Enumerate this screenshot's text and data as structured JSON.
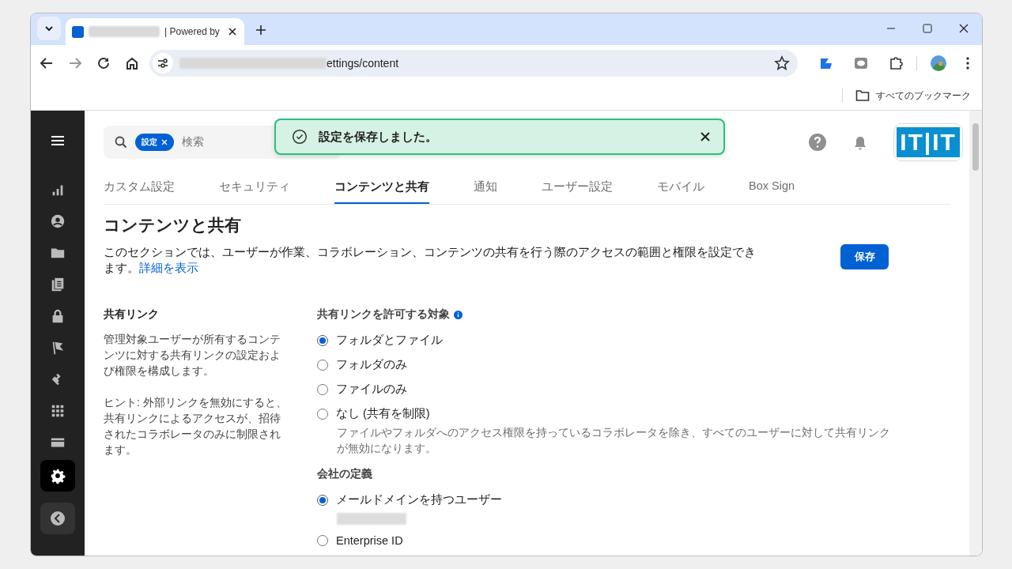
{
  "browser": {
    "tab_title": "| Powered by",
    "url": "ettings/content",
    "bookmarks_label": "すべてのブックマーク"
  },
  "sidebar": {
    "items": [
      {
        "kind": "reports",
        "selected": false
      },
      {
        "kind": "users",
        "selected": false
      },
      {
        "kind": "content",
        "selected": false
      },
      {
        "kind": "copies",
        "selected": false
      },
      {
        "kind": "security",
        "selected": false
      },
      {
        "kind": "flags",
        "selected": false
      },
      {
        "kind": "integrations",
        "selected": false
      },
      {
        "kind": "apps",
        "selected": false
      },
      {
        "kind": "billing",
        "selected": false
      },
      {
        "kind": "settings",
        "selected": true
      }
    ]
  },
  "search": {
    "chip": "設定",
    "placeholder": "検索"
  },
  "toast": {
    "message": "設定を保存しました。"
  },
  "logo": {
    "text": "IT|IT"
  },
  "tabs": [
    {
      "label": "カスタム設定",
      "selected": false
    },
    {
      "label": "セキュリティ",
      "selected": false
    },
    {
      "label": "コンテンツと共有",
      "selected": true
    },
    {
      "label": "通知",
      "selected": false
    },
    {
      "label": "ユーザー設定",
      "selected": false
    },
    {
      "label": "モバイル",
      "selected": false
    },
    {
      "label": "Box Sign",
      "selected": false
    }
  ],
  "heading": "コンテンツと共有",
  "description": "このセクションでは、ユーザーが作業、コラボレーション、コンテンツの共有を行う際のアクセスの範囲と権限を設定できます。",
  "details_link": "詳細を表示",
  "save_button": "保存",
  "section": {
    "title": "共有リンク",
    "description": "管理対象ユーザーが所有するコンテンツに対する共有リンクの設定および権限を構成します。",
    "hint": "ヒント: 外部リンクを無効にすると、共有リンクによるアクセスが、招待されたコラボレータのみに制限されます。"
  },
  "groups": [
    {
      "label": "共有リンクを許可する対象",
      "info": true,
      "options": [
        {
          "label": "フォルダとファイル",
          "selected": true
        },
        {
          "label": "フォルダのみ",
          "selected": false
        },
        {
          "label": "ファイルのみ",
          "selected": false
        },
        {
          "label": "なし (共有を制限)",
          "selected": false,
          "note": "ファイルやフォルダへのアクセス権限を持っているコラボレータを除き、すべてのユーザーに対して共有リンクが無効になります。"
        }
      ]
    },
    {
      "label": "会社の定義",
      "options": [
        {
          "label": "メールドメインを持つユーザー",
          "selected": true,
          "redacted": true
        },
        {
          "label": "Enterprise ID",
          "selected": false
        }
      ]
    }
  ]
}
